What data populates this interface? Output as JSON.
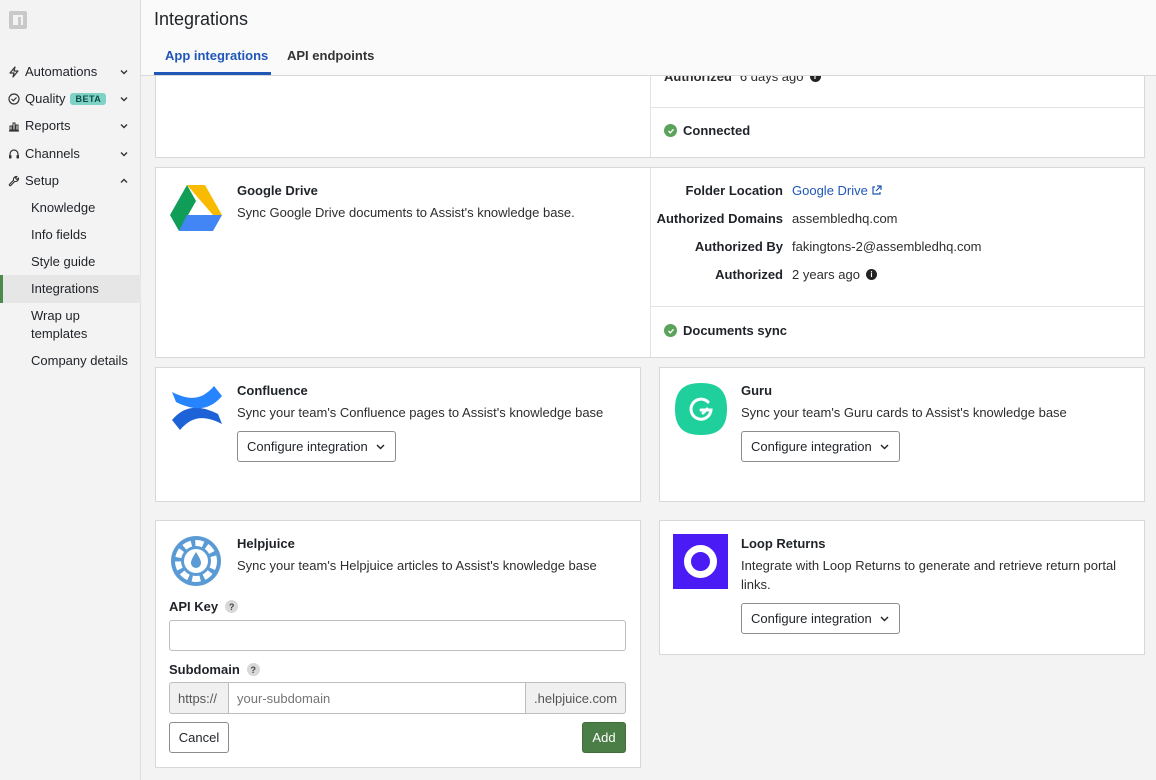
{
  "sidebar": {
    "nav": [
      {
        "label": "Automations",
        "icon": "bolt-icon"
      },
      {
        "label": "Quality",
        "icon": "check-circle-icon",
        "badge": "BETA"
      },
      {
        "label": "Reports",
        "icon": "bar-chart-icon"
      },
      {
        "label": "Channels",
        "icon": "headset-icon"
      },
      {
        "label": "Setup",
        "icon": "wrench-icon"
      }
    ],
    "setup_items": [
      "Knowledge",
      "Info fields",
      "Style guide",
      "Integrations",
      "Wrap up templates",
      "Company details"
    ]
  },
  "header": {
    "title": "Integrations",
    "tabs": [
      "App integrations",
      "API endpoints"
    ]
  },
  "top_card": {
    "authorized_label": "Authorized",
    "authorized_value": "6 days ago",
    "status": "Connected"
  },
  "google_drive": {
    "title": "Google Drive",
    "description": "Sync Google Drive documents to Assist's knowledge base.",
    "folder_location_label": "Folder Location",
    "folder_location_value": "Google Drive",
    "domains_label": "Authorized Domains",
    "domains_value": "assembledhq.com",
    "authorized_by_label": "Authorized By",
    "authorized_by_value": "fakingtons-2@assembledhq.com",
    "authorized_label": "Authorized",
    "authorized_value": "2 years ago",
    "status": "Documents sync"
  },
  "confluence": {
    "title": "Confluence",
    "description": "Sync your team's Confluence pages to Assist's knowledge base",
    "button": "Configure integration"
  },
  "guru": {
    "title": "Guru",
    "description": "Sync your team's Guru cards to Assist's knowledge base",
    "button": "Configure integration"
  },
  "helpjuice": {
    "title": "Helpjuice",
    "description": "Sync your team's Helpjuice articles to Assist's knowledge base",
    "api_key_label": "API Key",
    "api_key_value": "",
    "subdomain_label": "Subdomain",
    "subdomain_prefix": "https://",
    "subdomain_placeholder": "your-subdomain",
    "subdomain_suffix": ".helpjuice.com",
    "cancel": "Cancel",
    "add": "Add"
  },
  "loop_returns": {
    "title": "Loop Returns",
    "description": "Integrate with Loop Returns to generate and retrieve return portal links.",
    "button": "Configure integration"
  },
  "colors": {
    "accent": "#1f56b8",
    "success": "#5aa35a",
    "add_button": "#4b7d46",
    "guru": "#1fcf9c",
    "loop": "#4a1bf5"
  }
}
